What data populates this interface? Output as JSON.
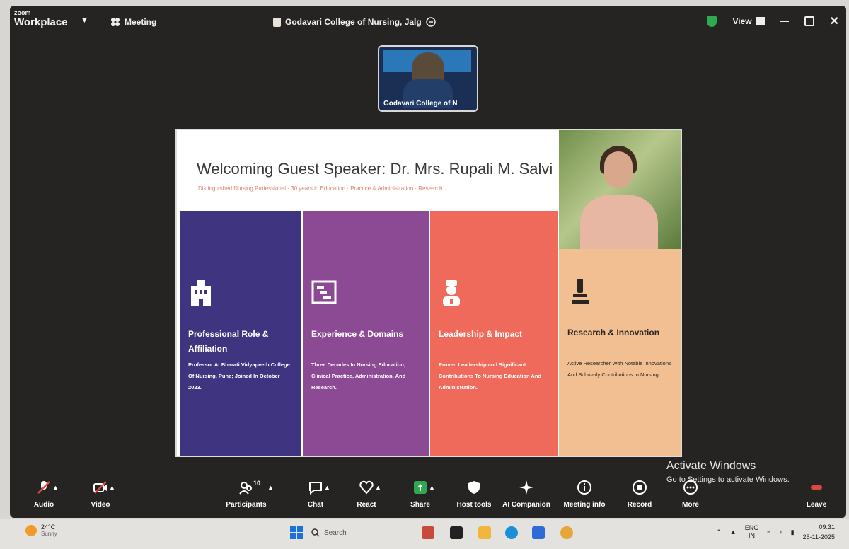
{
  "title_bar": {
    "brand_small": "zoom",
    "brand_big": "Workplace",
    "meeting_menu": "Meeting",
    "meeting_title": "Godavari College of Nursing, Jalg",
    "view_label": "View"
  },
  "self_video": {
    "label": "Godavari College of N"
  },
  "slide": {
    "title": "Welcoming Guest Speaker: Dr. Mrs. Rupali M. Salvi",
    "subtitle": "Distinguished Nursing Professional · 30 years in Education · Practice & Administration · Research",
    "panels": [
      {
        "title": "Professional Role & Affiliation",
        "text": "Professor At Bharati Vidyapeeth College Of Nursing, Pune; Joined In October 2023.",
        "icon": "building-icon"
      },
      {
        "title": "Experience & Domains",
        "text": "Three Decades In Nursing Education, Clinical Practice, Administration, And Research.",
        "icon": "chart-board-icon"
      },
      {
        "title": "Leadership & Impact",
        "text": "Proven Leadership and Significant Contributions To Nursing Education And Administration.",
        "icon": "nurse-icon"
      },
      {
        "title": "Research & Innovation",
        "text": "Active Researcher With Notable Innovations And Scholarly Contributions In Nursing.",
        "icon": "microscope-icon"
      }
    ]
  },
  "activate_windows": {
    "line1": "Activate Windows",
    "line2": "Go to Settings to activate Windows."
  },
  "toolbar": {
    "participants_count": "10",
    "items": {
      "audio": "Audio",
      "video": "Video",
      "participants": "Participants",
      "chat": "Chat",
      "react": "React",
      "share": "Share",
      "host_tools": "Host tools",
      "ai_companion": "AI Companion",
      "meeting_info": "Meeting info",
      "record": "Record",
      "more": "More",
      "leave": "Leave"
    }
  },
  "taskbar": {
    "weather_temp": "24°C",
    "weather_desc": "Sunny",
    "search_placeholder": "Search",
    "lang_line1": "ENG",
    "lang_line2": "IN",
    "time": "09:31",
    "date": "25-11-2025"
  },
  "colors": {
    "panel_1": "#3f3480",
    "panel_2": "#8c4a94",
    "panel_3": "#f06a5b",
    "panel_4": "#f1bf92",
    "share_green": "#2fa84f",
    "leave_red": "#e0473d"
  }
}
